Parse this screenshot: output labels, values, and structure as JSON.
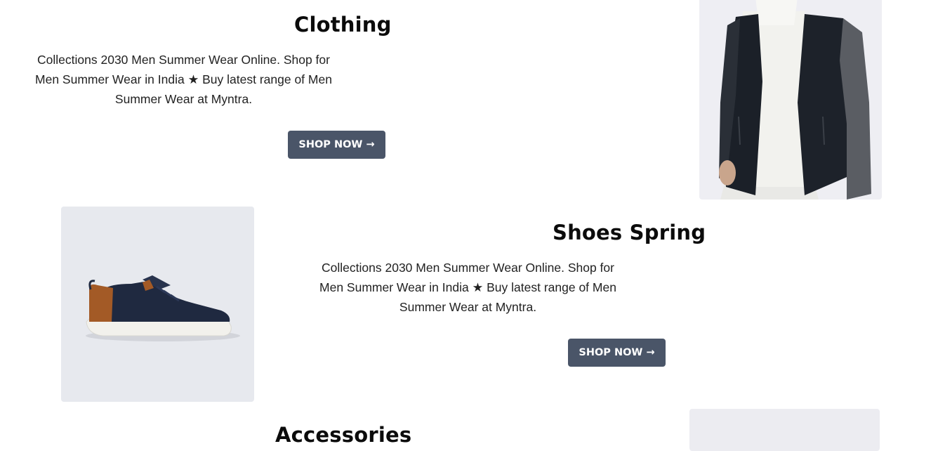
{
  "sections": [
    {
      "id": "clothing",
      "title": "Clothing",
      "description": "Collections 2030 Men Summer Wear Online. Shop for Men Summer Wear in India ★ Buy latest range of Men Summer Wear at Myntra.",
      "button_label": "SHOP NOW →",
      "image_icon": "jacket-product-photo"
    },
    {
      "id": "shoes-spring",
      "title": "Shoes Spring",
      "description": "Collections 2030 Men Summer Wear Online. Shop for Men Summer Wear in India ★ Buy latest range of Men Summer Wear at Myntra.",
      "button_label": "SHOP NOW →",
      "image_icon": "sneaker-product-photo"
    },
    {
      "id": "accessories",
      "title": "Accessories",
      "image_icon": "accessories-product-photo"
    }
  ],
  "colors": {
    "button_bg": "#4a5568",
    "button_text": "#ffffff",
    "image_bg": "#eceef3"
  }
}
